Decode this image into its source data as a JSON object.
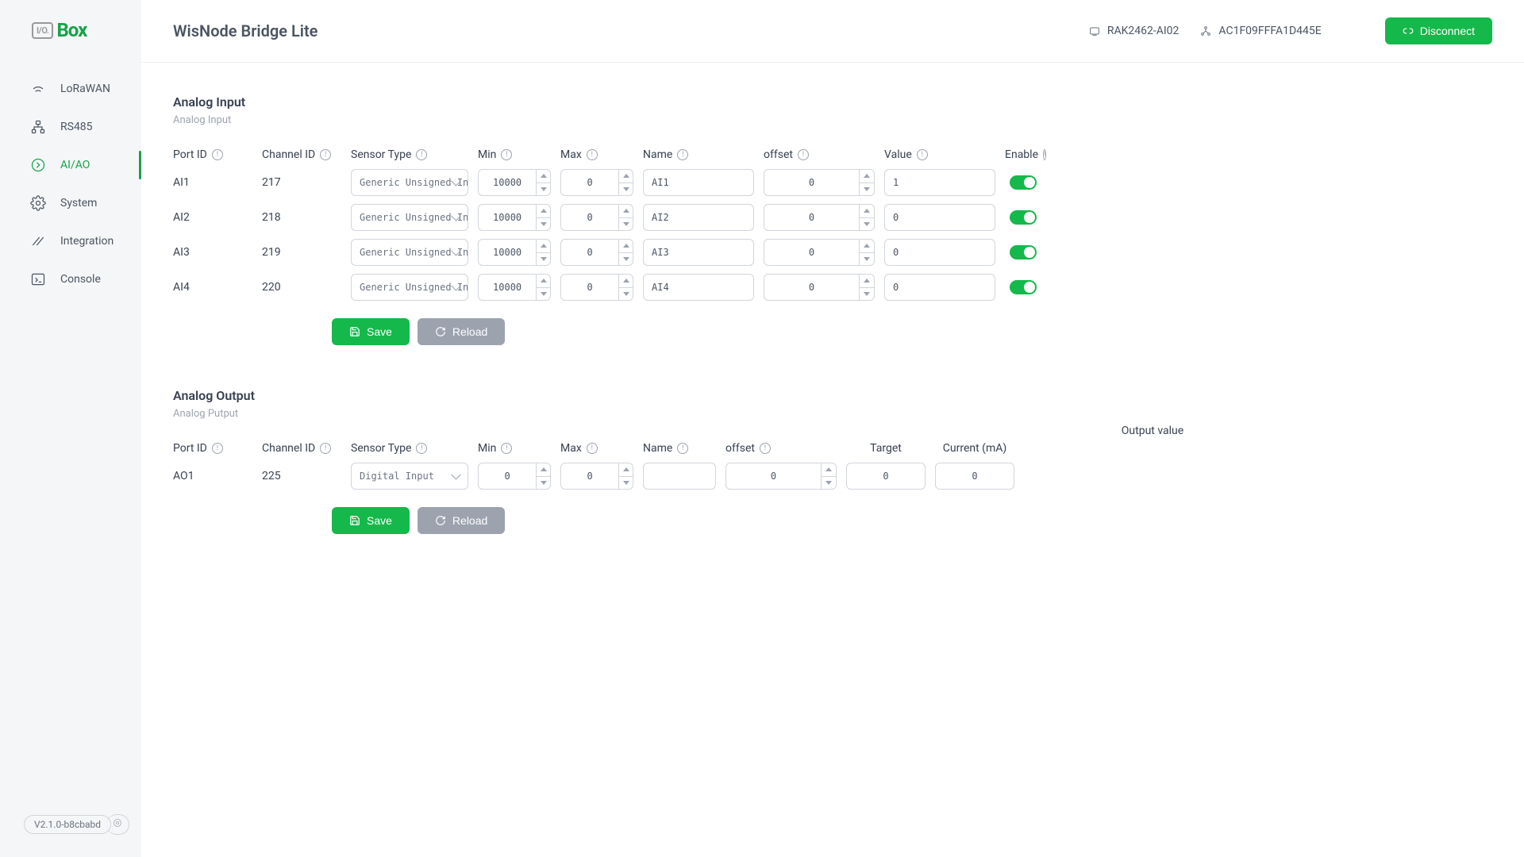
{
  "logo": {
    "io": "I/O.",
    "text": "Box"
  },
  "sidebar": {
    "items": [
      {
        "label": "LoRaWAN"
      },
      {
        "label": "RS485"
      },
      {
        "label": "AI/AO"
      },
      {
        "label": "System"
      },
      {
        "label": "Integration"
      },
      {
        "label": "Console"
      }
    ]
  },
  "version": "V2.1.0-b8cbabd",
  "header": {
    "title": "WisNode Bridge Lite",
    "device_name": "RAK2462-AI02",
    "device_id": "AC1F09FFFA1D445E",
    "disconnect_label": "Disconnect"
  },
  "sections": {
    "ai": {
      "title": "Analog Input",
      "subtitle": "Analog Input",
      "columns": {
        "port_id": "Port ID",
        "channel_id": "Channel ID",
        "sensor_type": "Sensor Type",
        "min": "Min",
        "max": "Max",
        "name": "Name",
        "offset": "offset",
        "value": "Value",
        "enable": "Enable"
      },
      "rows": [
        {
          "port_id": "AI1",
          "channel_id": "217",
          "sensor_type": "Generic Unsigned Int…",
          "min": "10000",
          "max": "0",
          "name": "AI1",
          "offset": "0",
          "value": "1",
          "enable": true
        },
        {
          "port_id": "AI2",
          "channel_id": "218",
          "sensor_type": "Generic Unsigned Int…",
          "min": "10000",
          "max": "0",
          "name": "AI2",
          "offset": "0",
          "value": "0",
          "enable": true
        },
        {
          "port_id": "AI3",
          "channel_id": "219",
          "sensor_type": "Generic Unsigned Int…",
          "min": "10000",
          "max": "0",
          "name": "AI3",
          "offset": "0",
          "value": "0",
          "enable": true
        },
        {
          "port_id": "AI4",
          "channel_id": "220",
          "sensor_type": "Generic Unsigned Int…",
          "min": "10000",
          "max": "0",
          "name": "AI4",
          "offset": "0",
          "value": "0",
          "enable": true
        }
      ]
    },
    "ao": {
      "title": "Analog Output",
      "subtitle": "Analog Putput",
      "columns": {
        "port_id": "Port ID",
        "channel_id": "Channel ID",
        "sensor_type": "Sensor Type",
        "min": "Min",
        "max": "Max",
        "name": "Name",
        "offset": "offset",
        "output_value": "Output value",
        "target": "Target",
        "current": "Current (mA)"
      },
      "rows": [
        {
          "port_id": "AO1",
          "channel_id": "225",
          "sensor_type": "Digital Input",
          "min": "0",
          "max": "0",
          "name": "",
          "offset": "0",
          "target": "0",
          "current": "0"
        }
      ]
    }
  },
  "buttons": {
    "save": "Save",
    "reload": "Reload"
  }
}
